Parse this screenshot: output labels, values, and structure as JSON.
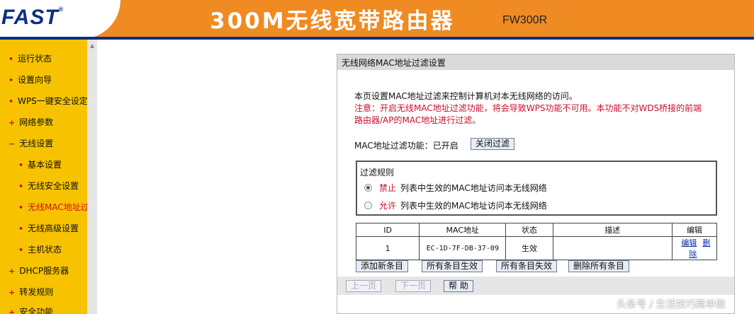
{
  "header": {
    "brand": "FAST",
    "brand_reg": "®",
    "title": "300M无线宽带路由器",
    "model": "FW300R"
  },
  "sidebar": {
    "items": [
      {
        "label": "运行状态",
        "bullet": "•"
      },
      {
        "label": "设置向导",
        "bullet": "•"
      },
      {
        "label": "WPS一键安全设定",
        "bullet": "•"
      },
      {
        "label": "网络参数",
        "bullet": "+"
      },
      {
        "label": "无线设置",
        "bullet": "−"
      },
      {
        "label": "基本设置",
        "bullet": "•"
      },
      {
        "label": "无线安全设置",
        "bullet": "•"
      },
      {
        "label": "无线MAC地址过滤",
        "bullet": "•"
      },
      {
        "label": "无线高级设置",
        "bullet": "•"
      },
      {
        "label": "主机状态",
        "bullet": "•"
      },
      {
        "label": "DHCP服务器",
        "bullet": "+"
      },
      {
        "label": "转发规则",
        "bullet": "+"
      },
      {
        "label": "安全功能",
        "bullet": "+"
      }
    ]
  },
  "panel": {
    "title": "无线网络MAC地址过滤设置",
    "description": "本页设置MAC地址过滤来控制计算机对本无线网络的访问。",
    "warning": "注意：开启无线MAC地址过滤功能，将会导致WPS功能不可用。本功能不对WDS桥接的前端路由器/AP的MAC地址进行过滤。",
    "filter_status_label": "MAC地址过滤功能：已开启",
    "toggle_button": "关闭过滤",
    "rules": {
      "title": "过滤规则",
      "deny_keyword": "禁止",
      "deny_text": "列表中生效的MAC地址访问本无线网络",
      "allow_keyword": "允许",
      "allow_text": "列表中生效的MAC地址访问本无线网络",
      "selected": "deny"
    },
    "table": {
      "headers": [
        "ID",
        "MAC地址",
        "状态",
        "描述",
        "编辑"
      ],
      "rows": [
        {
          "id": "1",
          "mac": "EC-1D-7F-DB-37-09",
          "status": "生效",
          "desc": "",
          "edit": "编辑",
          "delete": "删除"
        }
      ]
    },
    "actions": {
      "add": "添加新条目",
      "enable_all": "所有条目生效",
      "disable_all": "所有条目失效",
      "delete_all": "删除所有条目"
    },
    "pager": {
      "prev": "上一页",
      "next": "下一页",
      "help": "帮 助"
    }
  },
  "watermark": "头条号 / 生活技巧简单做",
  "colors": {
    "header_orange": "#f08a22",
    "brand_blue": "#0b2f86",
    "sidebar_yellow": "#f7c300",
    "warning_red": "#c8102e"
  }
}
